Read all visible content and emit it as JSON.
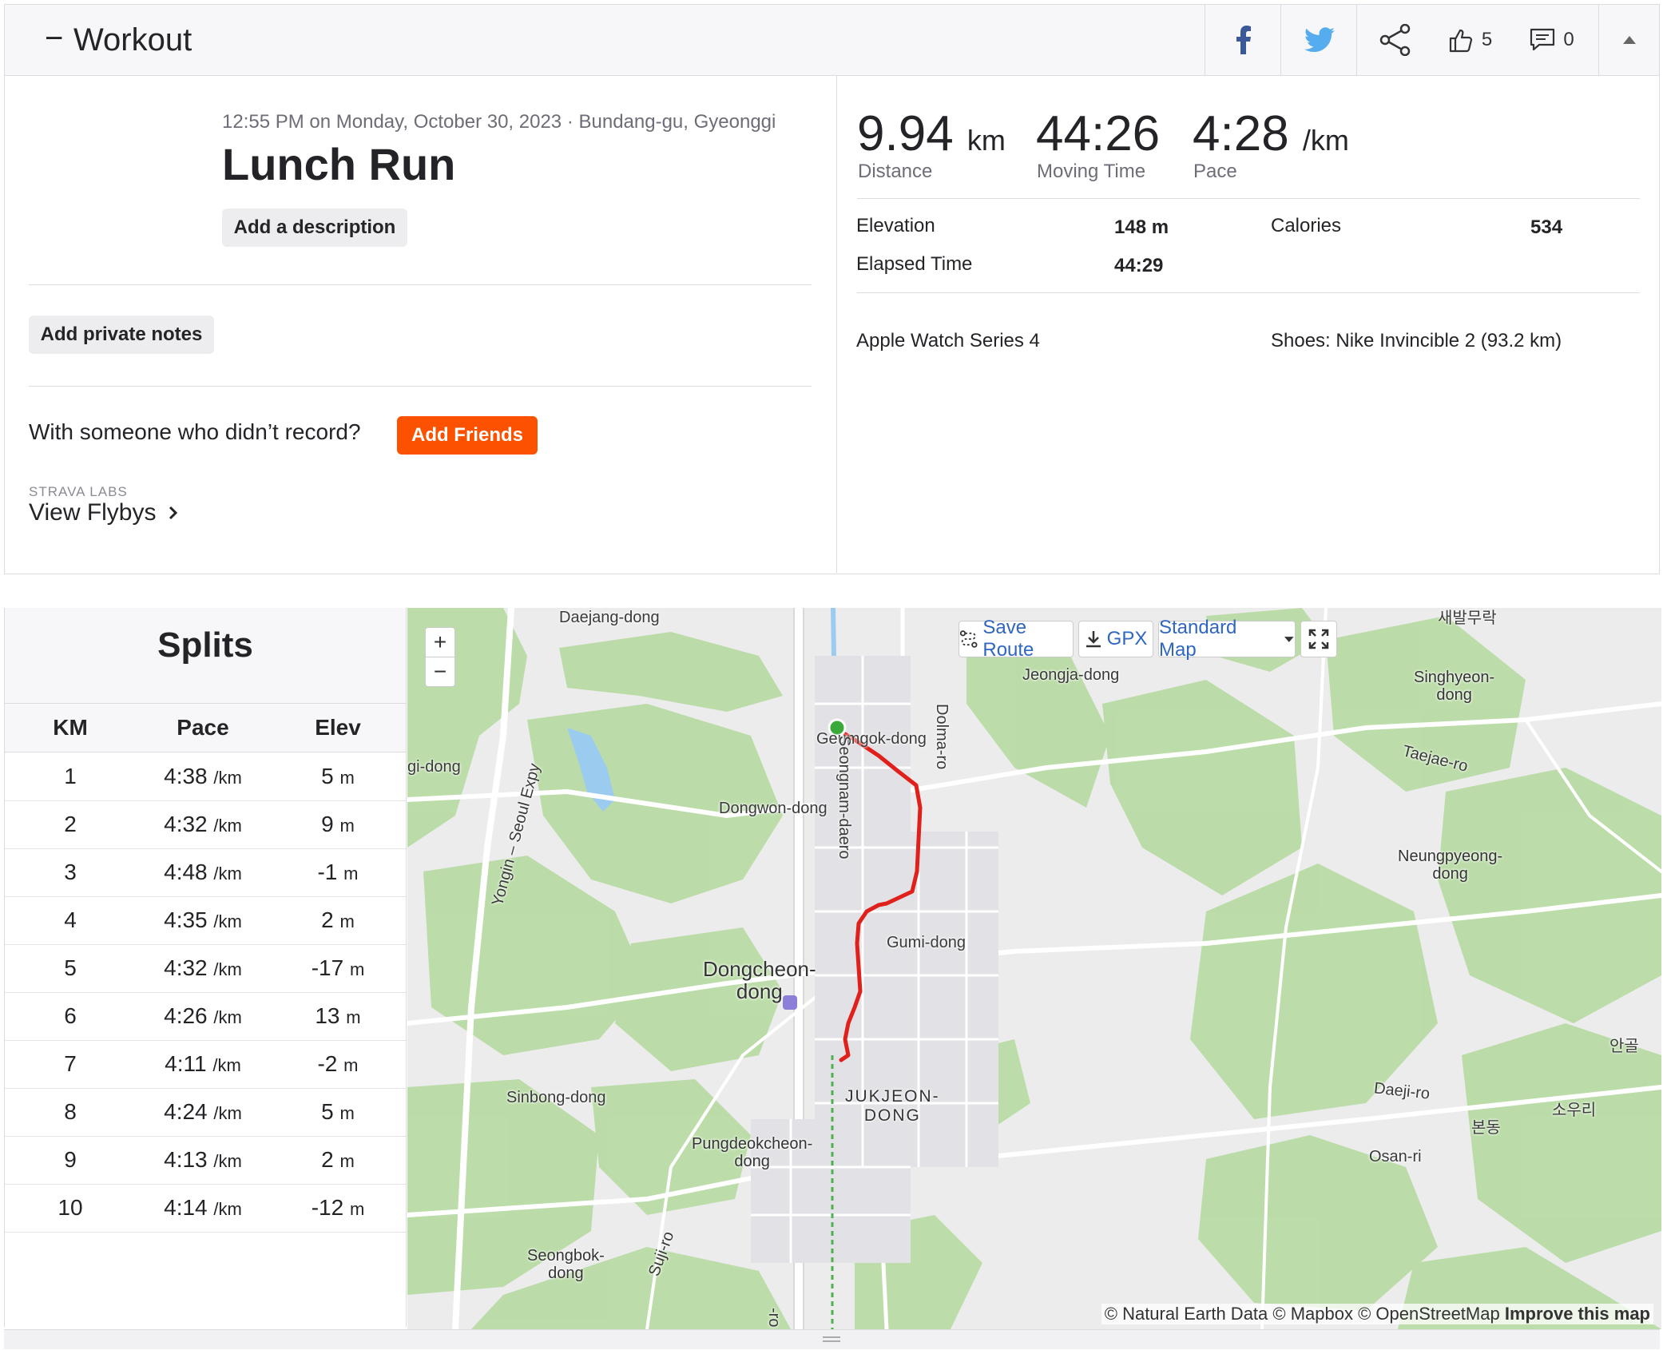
{
  "header": {
    "title": "Workout",
    "kudos_count": "5",
    "comments_count": "0",
    "brand_colors": {
      "facebook": "#3b5998",
      "twitter": "#55acee",
      "accent": "#fc5200"
    }
  },
  "activity": {
    "meta": "12:55 PM on Monday, October 30, 2023 · Bundang-gu, Gyeonggi",
    "name": "Lunch Run",
    "add_description_label": "Add a description",
    "add_notes_label": "Add private notes",
    "with_someone_text": "With someone who didn’t record?",
    "add_friends_label": "Add Friends",
    "labs_label": "STRAVA LABS",
    "flybys_label": "View Flybys"
  },
  "stats": {
    "distance": {
      "value": "9.94",
      "unit": "km",
      "label": "Distance"
    },
    "moving_time": {
      "value": "44:26",
      "label": "Moving Time"
    },
    "pace": {
      "value": "4:28",
      "unit": "/km",
      "label": "Pace"
    },
    "elevation": {
      "label": "Elevation",
      "value": "148 m"
    },
    "elapsed": {
      "label": "Elapsed Time",
      "value": "44:29"
    },
    "calories": {
      "label": "Calories",
      "value": "534"
    },
    "device": "Apple Watch Series 4",
    "shoes": "Shoes: Nike Invincible 2 (93.2 km)"
  },
  "splits": {
    "title": "Splits",
    "columns": [
      "KM",
      "Pace",
      "Elev"
    ],
    "pace_unit": "/km",
    "elev_unit": "m",
    "rows": [
      {
        "km": "1",
        "pace": "4:38",
        "elev": "5"
      },
      {
        "km": "2",
        "pace": "4:32",
        "elev": "9"
      },
      {
        "km": "3",
        "pace": "4:48",
        "elev": "-1"
      },
      {
        "km": "4",
        "pace": "4:35",
        "elev": "2"
      },
      {
        "km": "5",
        "pace": "4:32",
        "elev": "-17"
      },
      {
        "km": "6",
        "pace": "4:26",
        "elev": "13"
      },
      {
        "km": "7",
        "pace": "4:11",
        "elev": "-2"
      },
      {
        "km": "8",
        "pace": "4:24",
        "elev": "5"
      },
      {
        "km": "9",
        "pace": "4:13",
        "elev": "2"
      },
      {
        "km": "10",
        "pace": "4:14",
        "elev": "-12"
      }
    ]
  },
  "map": {
    "zoom_in": "+",
    "zoom_out": "−",
    "save_route_label": "Save Route",
    "gpx_label": "GPX",
    "map_type_label": "Standard Map",
    "attribution": "© Natural Earth Data © Mapbox © OpenStreetMap",
    "improve_label": "Improve this map",
    "route_color": "#e0201b",
    "start_color": "#3aa93a",
    "labels": {
      "daejang": "Daejang-dong",
      "saebal": "새발무락",
      "jeongja": "Jeongja-dong",
      "singhyeon": "Singhyeon-\ndong",
      "geumgok": "Geumgok-dong",
      "gidong": "gi-dong",
      "dolma": "Dolma-ro",
      "taejae": "Taejae-ro",
      "dongwon": "Dongwon-dong",
      "yongin": "Yongin – Seoul Expy",
      "seongnam": "Seongnam-daero",
      "neungpyeong": "Neungpyeong-\ndong",
      "gumi": "Gumi-dong",
      "dongcheon": "Dongcheon-\ndong",
      "angol": "안골",
      "sinbong": "Sinbong-dong",
      "jukjeon": "JUKJEON-\nDONG",
      "daeji": "Daeji-ro",
      "souri": "소우리",
      "bondong": "본동",
      "pungdeok": "Pungdeokcheon-\ndong",
      "osan": "Osan-ri",
      "suji": "Suji-ro",
      "seongbok": "Seongbok-\ndong",
      "ro": "-ro"
    }
  }
}
